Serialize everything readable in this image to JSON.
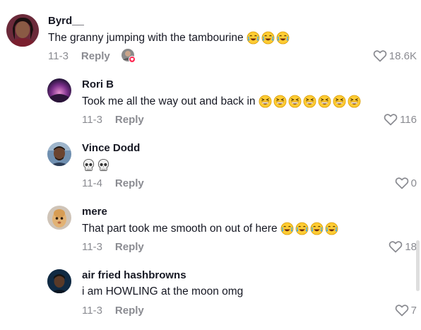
{
  "comments": [
    {
      "username": "Byrd__",
      "text": "The granny jumping with the tambourine",
      "emoji": "crying-laughing-emoji",
      "emoji_count": 3,
      "date": "11-3",
      "reply_label": "Reply",
      "likes": "18.6K"
    },
    {
      "username": "Rori B",
      "text": "Took me all the way out and back in",
      "emoji": "grinning-squint-emoji",
      "emoji_count": 7,
      "date": "11-3",
      "reply_label": "Reply",
      "likes": "116"
    },
    {
      "username": "Vince Dodd",
      "text": "",
      "emoji": "skull-emoji",
      "emoji_count": 2,
      "date": "11-4",
      "reply_label": "Reply",
      "likes": "0"
    },
    {
      "username": "mere",
      "text": "That part took me smooth on out of here",
      "emoji": "crying-laughing-emoji",
      "emoji_count": 4,
      "date": "11-3",
      "reply_label": "Reply",
      "likes": "18"
    },
    {
      "username": "air fried hashbrowns",
      "text": "i am HOWLING at the moon omg",
      "emoji": "",
      "emoji_count": 0,
      "date": "11-3",
      "reply_label": "Reply",
      "likes": "7"
    }
  ],
  "colors": {
    "text": "#161823",
    "muted": "#8a8b91",
    "badge": "#fe2c55"
  }
}
